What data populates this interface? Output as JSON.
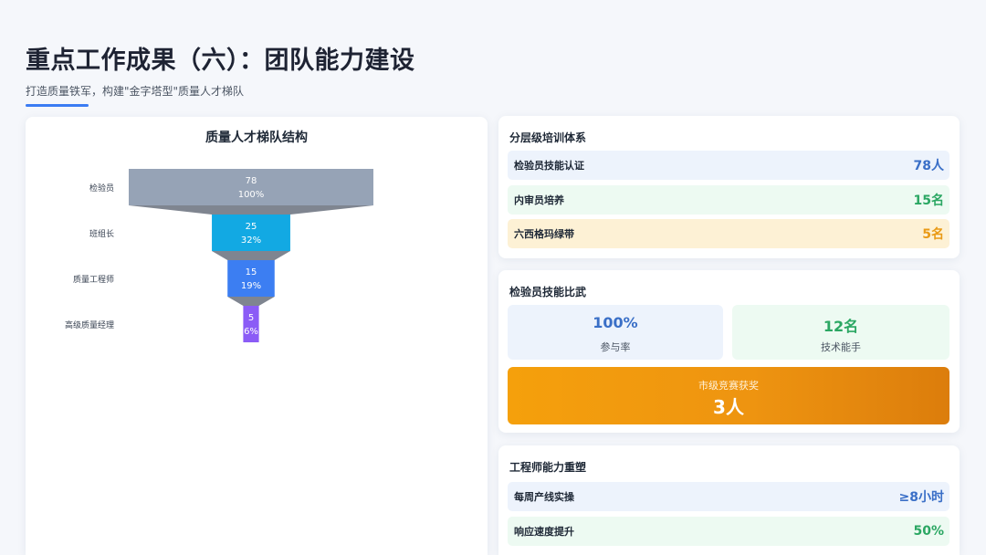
{
  "header": {
    "title": "重点工作成果（六）：团队能力建设",
    "subtitle": "打造质量铁军，构建\"金字塔型\"质量人才梯队"
  },
  "funnel": {
    "title": "质量人才梯队结构"
  },
  "chart_data": {
    "type": "funnel",
    "title": "质量人才梯队结构",
    "categories": [
      "检验员",
      "班组长",
      "质量工程师",
      "高级质量经理"
    ],
    "values": [
      78,
      25,
      15,
      5
    ],
    "percent_labels": [
      "100%",
      "32%",
      "19%",
      "6%"
    ],
    "colors": [
      "#96a3b6",
      "#12a9e3",
      "#3c7ef2",
      "#8b5cf6"
    ],
    "connector_color": "#7f8590"
  },
  "training": {
    "title": "分层级培训体系",
    "items": [
      {
        "label": "检验员技能认证",
        "value": "78人"
      },
      {
        "label": "内审员培养",
        "value": "15名"
      },
      {
        "label": "六西格玛绿带",
        "value": "5名"
      }
    ]
  },
  "contest": {
    "title": "检验员技能比武",
    "participation_value": "100%",
    "participation_label": "参与率",
    "experts_value": "12名",
    "experts_label": "技术能手",
    "award_label": "市级竞赛获奖",
    "award_value": "3人"
  },
  "engineer": {
    "title": "工程师能力重塑",
    "items": [
      {
        "label": "每周产线实操",
        "value": "≥8小时"
      },
      {
        "label": "响应速度提升",
        "value": "50%"
      }
    ]
  },
  "colors": {
    "accent_blue": "#3b7cf3",
    "award_orange": "#f5a00c"
  }
}
